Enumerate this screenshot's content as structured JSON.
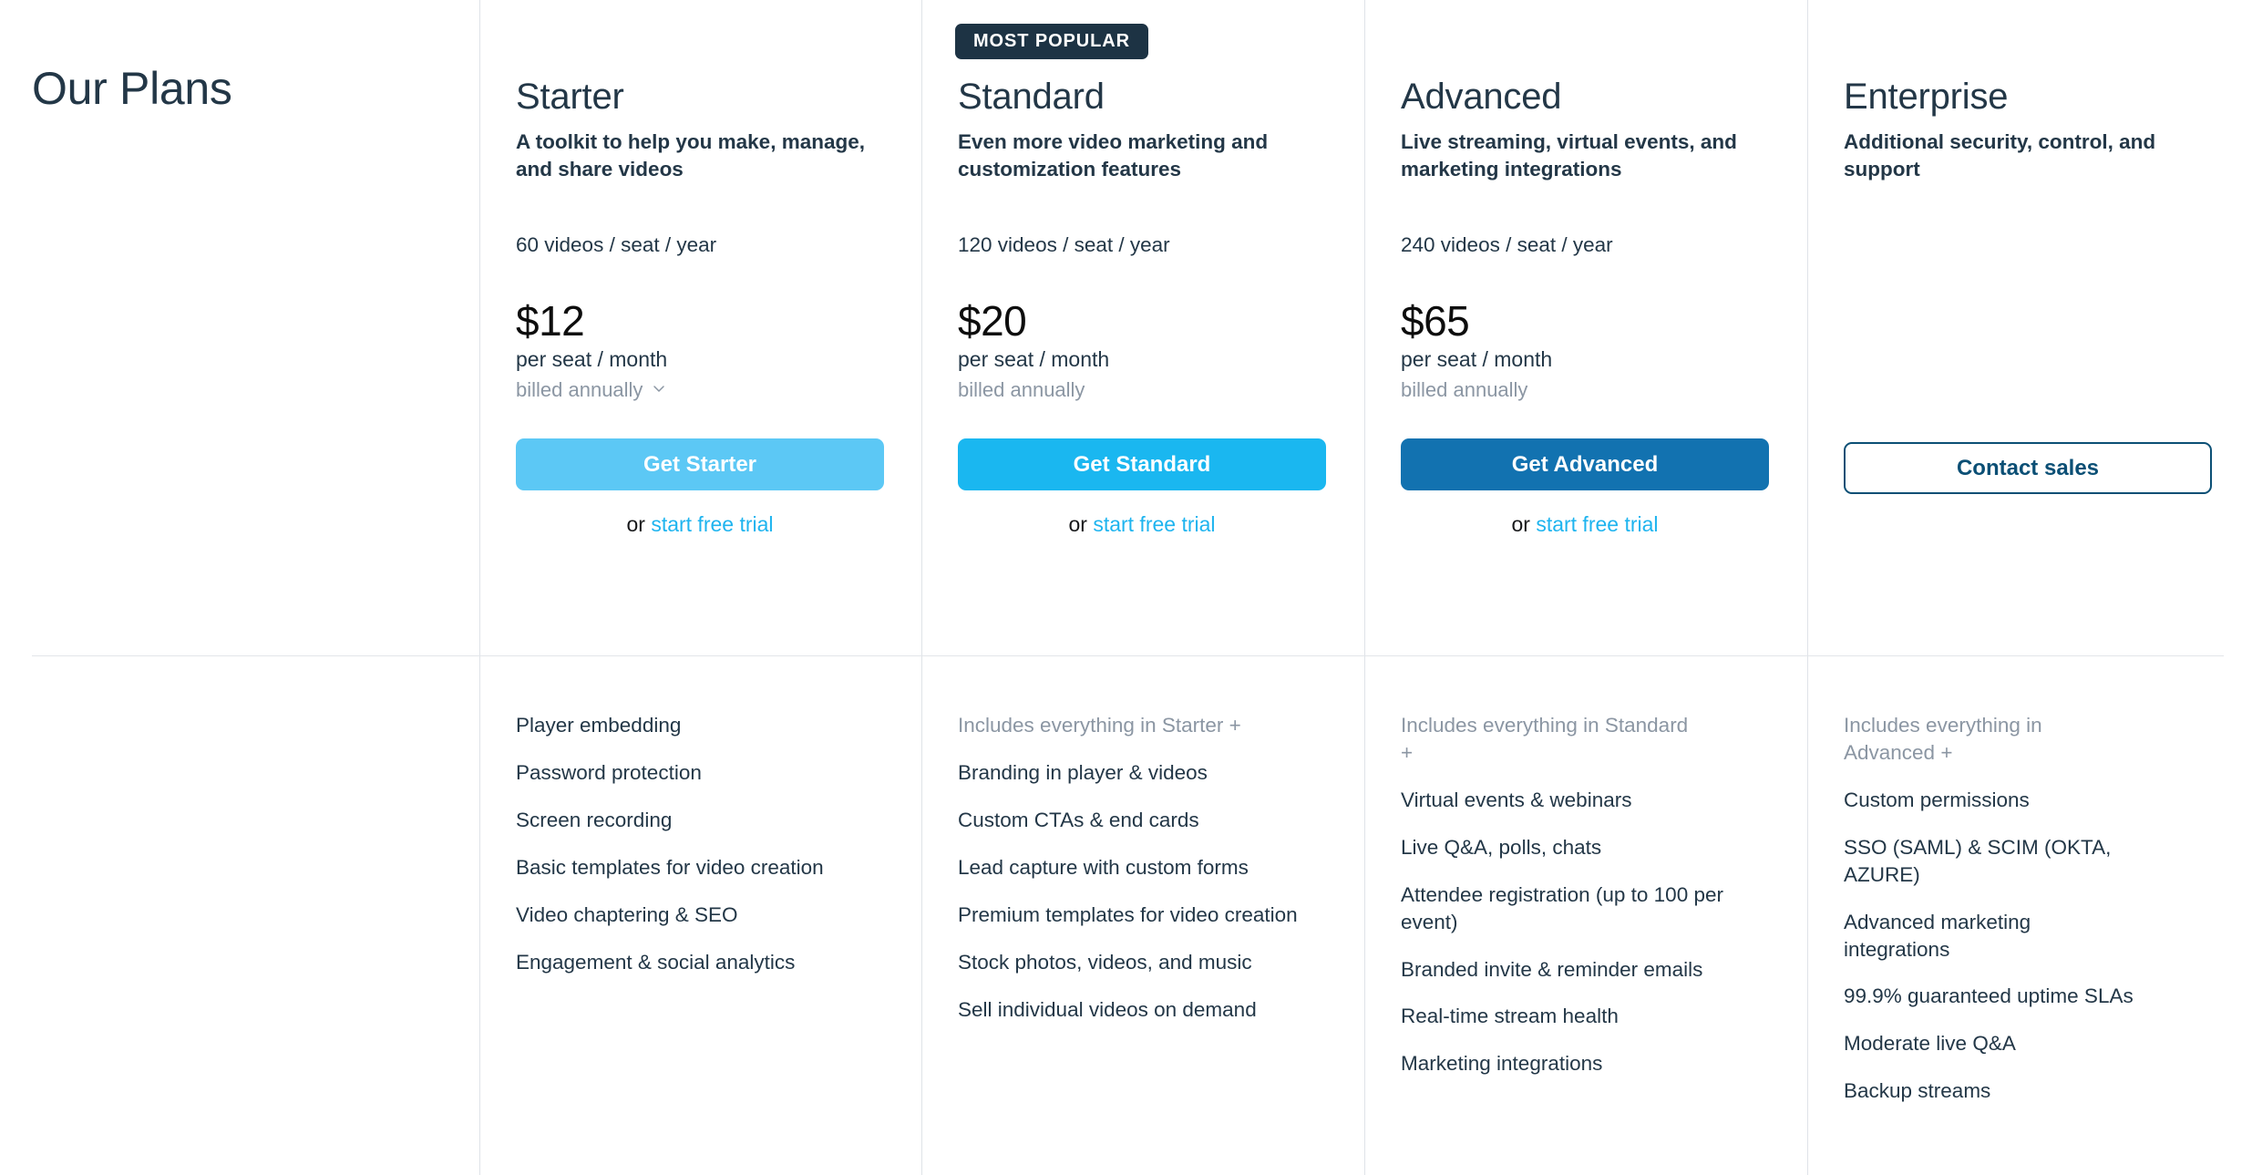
{
  "page_title": "Our Plans",
  "badge": {
    "label": "MOST POPULAR"
  },
  "colors": {
    "text_navy": "#233747",
    "text_muted": "#8b96a3",
    "price": "#0d0d0d",
    "link_blue": "#1eb4ef",
    "starter_button": "#5cc8f5",
    "standard_button": "#1ab7f0",
    "advanced_button": "#1272b0",
    "enterprise_border": "#0b4f75",
    "badge_background": "#1d3344",
    "divider": "#dfe3e8"
  },
  "trial": {
    "prefix": "or ",
    "link_label": "start free trial"
  },
  "billing": {
    "label": "billed annually",
    "chevron_icon": "chevron-down-icon"
  },
  "plans": [
    {
      "name": "Starter",
      "description": "A toolkit to help you make, manage, and share videos",
      "quota": "60 videos / seat / year",
      "price": "$12",
      "price_unit": "per seat / month",
      "billed": "billed annually",
      "cta_label": "Get Starter",
      "has_trial": true,
      "features_header": null,
      "features": [
        "Player embedding",
        "Password protection",
        "Screen recording",
        "Basic templates for video creation",
        "Video chaptering & SEO",
        "Engagement & social analytics"
      ]
    },
    {
      "name": "Standard",
      "description": "Even more video marketing and customization features",
      "quota": "120 videos / seat / year",
      "price": "$20",
      "price_unit": "per seat / month",
      "billed": "billed annually",
      "cta_label": "Get Standard",
      "has_trial": true,
      "features_header": "Includes everything in Starter +",
      "features": [
        "Branding in player & videos",
        "Custom CTAs & end cards",
        "Lead capture with custom forms",
        "Premium templates for video creation",
        "Stock photos, videos, and music",
        "Sell individual videos on demand"
      ]
    },
    {
      "name": "Advanced",
      "description": "Live streaming, virtual events, and marketing integrations",
      "quota": "240 videos / seat / year",
      "price": "$65",
      "price_unit": "per seat / month",
      "billed": "billed annually",
      "cta_label": "Get Advanced",
      "has_trial": true,
      "features_header": "Includes everything in Standard +",
      "features": [
        "Virtual events & webinars",
        "Live Q&A, polls, chats",
        "Attendee registration (up to 100 per event)",
        "Branded invite & reminder emails",
        "Real-time stream health",
        "Marketing integrations"
      ]
    },
    {
      "name": "Enterprise",
      "description": "Additional security, control, and support",
      "quota": "",
      "price": "",
      "price_unit": "",
      "billed": "",
      "cta_label": "Contact sales",
      "has_trial": false,
      "features_header": "Includes everything in Advanced +",
      "features": [
        "Custom permissions",
        "SSO (SAML) & SCIM (OKTA, AZURE)",
        "Advanced marketing integrations",
        "99.9% guaranteed uptime SLAs",
        "Moderate live Q&A",
        "Backup streams"
      ]
    }
  ]
}
